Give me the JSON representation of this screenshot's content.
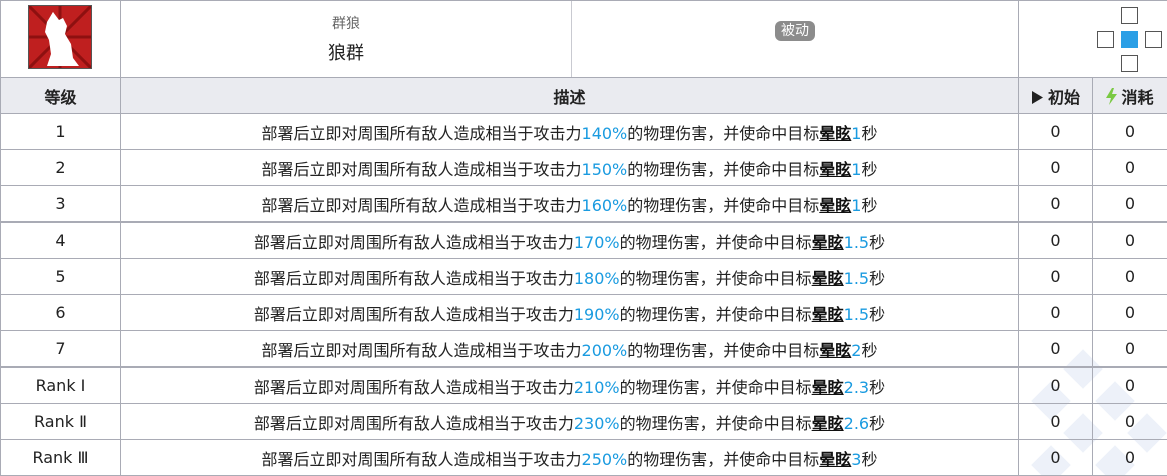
{
  "skill": {
    "subtitle": "群狼",
    "name": "狼群",
    "type_badge": "被动"
  },
  "columns": {
    "level": "等级",
    "description": "描述",
    "initial": "初始",
    "cost": "消耗"
  },
  "rows": [
    {
      "level": "1",
      "pre": "部署后立即对周围所有敌人造成相当于攻击力",
      "pct": "140%",
      "mid": "的物理伤害，并使命中目标",
      "kw": "晕眩",
      "sec": "1",
      "unit": "秒",
      "initial": "0",
      "cost": "0"
    },
    {
      "level": "2",
      "pre": "部署后立即对周围所有敌人造成相当于攻击力",
      "pct": "150%",
      "mid": "的物理伤害，并使命中目标",
      "kw": "晕眩",
      "sec": "1",
      "unit": "秒",
      "initial": "0",
      "cost": "0"
    },
    {
      "level": "3",
      "pre": "部署后立即对周围所有敌人造成相当于攻击力",
      "pct": "160%",
      "mid": "的物理伤害，并使命中目标",
      "kw": "晕眩",
      "sec": "1",
      "unit": "秒",
      "initial": "0",
      "cost": "0"
    },
    {
      "level": "4",
      "pre": "部署后立即对周围所有敌人造成相当于攻击力",
      "pct": "170%",
      "mid": "的物理伤害，并使命中目标",
      "kw": "晕眩",
      "sec": "1.5",
      "unit": "秒",
      "initial": "0",
      "cost": "0"
    },
    {
      "level": "5",
      "pre": "部署后立即对周围所有敌人造成相当于攻击力",
      "pct": "180%",
      "mid": "的物理伤害，并使命中目标",
      "kw": "晕眩",
      "sec": "1.5",
      "unit": "秒",
      "initial": "0",
      "cost": "0"
    },
    {
      "level": "6",
      "pre": "部署后立即对周围所有敌人造成相当于攻击力",
      "pct": "190%",
      "mid": "的物理伤害，并使命中目标",
      "kw": "晕眩",
      "sec": "1.5",
      "unit": "秒",
      "initial": "0",
      "cost": "0"
    },
    {
      "level": "7",
      "pre": "部署后立即对周围所有敌人造成相当于攻击力",
      "pct": "200%",
      "mid": "的物理伤害，并使命中目标",
      "kw": "晕眩",
      "sec": "2",
      "unit": "秒",
      "initial": "0",
      "cost": "0"
    },
    {
      "level": "Rank Ⅰ",
      "pre": "部署后立即对周围所有敌人造成相当于攻击力",
      "pct": "210%",
      "mid": "的物理伤害，并使命中目标",
      "kw": "晕眩",
      "sec": "2.3",
      "unit": "秒",
      "initial": "0",
      "cost": "0"
    },
    {
      "level": "Rank Ⅱ",
      "pre": "部署后立即对周围所有敌人造成相当于攻击力",
      "pct": "230%",
      "mid": "的物理伤害，并使命中目标",
      "kw": "晕眩",
      "sec": "2.6",
      "unit": "秒",
      "initial": "0",
      "cost": "0"
    },
    {
      "level": "Rank Ⅲ",
      "pre": "部署后立即对周围所有敌人造成相当于攻击力",
      "pct": "250%",
      "mid": "的物理伤害，并使命中目标",
      "kw": "晕眩",
      "sec": "3",
      "unit": "秒",
      "initial": "0",
      "cost": "0"
    }
  ],
  "colors": {
    "value_highlight": "#1a9be0",
    "icon_background": "#bf1f1f",
    "range_self": "#2b9fe6",
    "initial_icon": "#222222",
    "cost_icon": "#7ac943"
  },
  "icons": {
    "skill": "wolf-howl-icon",
    "initial": "play-triangle-icon",
    "cost": "lightning-bolt-icon"
  }
}
